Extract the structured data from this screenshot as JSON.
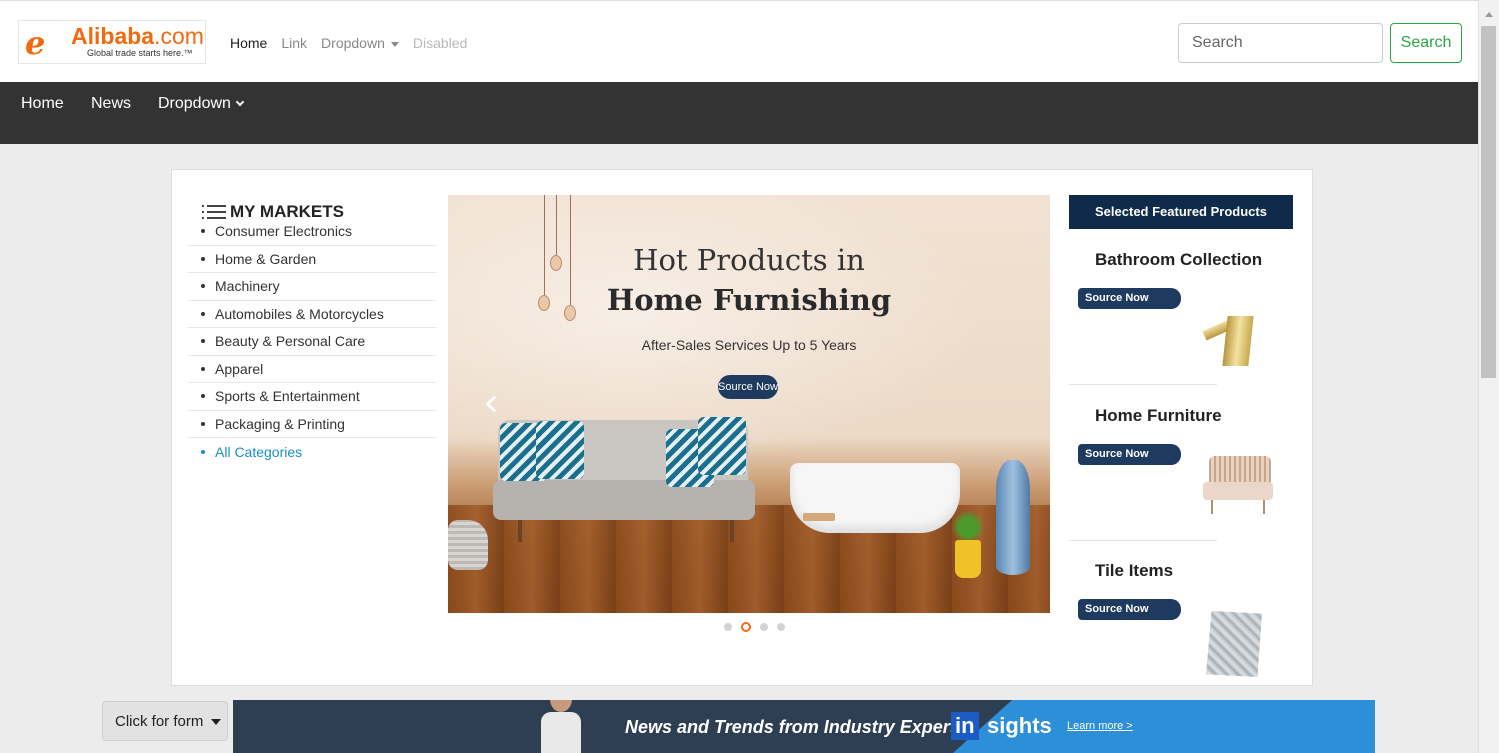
{
  "topbar": {
    "logo": {
      "word": "Alibaba",
      "suffix": ".com",
      "tagline": "Global trade starts here.™"
    },
    "nav": [
      {
        "label": "Home"
      },
      {
        "label": "Link"
      },
      {
        "label": "Dropdown"
      },
      {
        "label": "Disabled"
      }
    ],
    "search": {
      "placeholder": "Search",
      "button_label": "Search"
    }
  },
  "darknav": {
    "items": [
      {
        "label": "Home"
      },
      {
        "label": "News"
      },
      {
        "label": "Dropdown"
      }
    ]
  },
  "markets": {
    "title": "MY MARKETS",
    "items": [
      {
        "label": "Consumer Electronics"
      },
      {
        "label": "Home & Garden"
      },
      {
        "label": "Machinery"
      },
      {
        "label": "Automobiles & Motorcycles"
      },
      {
        "label": "Beauty & Personal Care"
      },
      {
        "label": "Apparel"
      },
      {
        "label": "Sports & Entertainment"
      },
      {
        "label": "Packaging & Printing"
      },
      {
        "label": "All Categories"
      }
    ]
  },
  "banner": {
    "title_line1": "Hot Products in",
    "title_line2": "Home Furnishing",
    "subtitle": "After-Sales Services Up to 5 Years",
    "button_label": "Source Now",
    "slides_total": 4,
    "active_slide": 2
  },
  "featured": {
    "heading": "Selected Featured Products",
    "items": [
      {
        "name": "Bathroom Collection",
        "button_label": "Source Now",
        "image_icon": "faucet-image"
      },
      {
        "name": "Home Furniture",
        "button_label": "Source Now",
        "image_icon": "armchair-image"
      },
      {
        "name": "Tile Items",
        "button_label": "Source Now",
        "image_icon": "mosaic-tile-image"
      }
    ]
  },
  "bottom": {
    "form_button_label": "Click for form",
    "promo": {
      "text": "News and Trends from Industry Experts",
      "brand_in": "in",
      "brand_rest": "sights",
      "link_label": "Learn more >"
    }
  },
  "colors": {
    "brand_orange": "#f26a10",
    "dark_nav": "#333333",
    "navy": "#0f2a4a",
    "search_green": "#28a745",
    "link_blue": "#1a8fc7"
  }
}
